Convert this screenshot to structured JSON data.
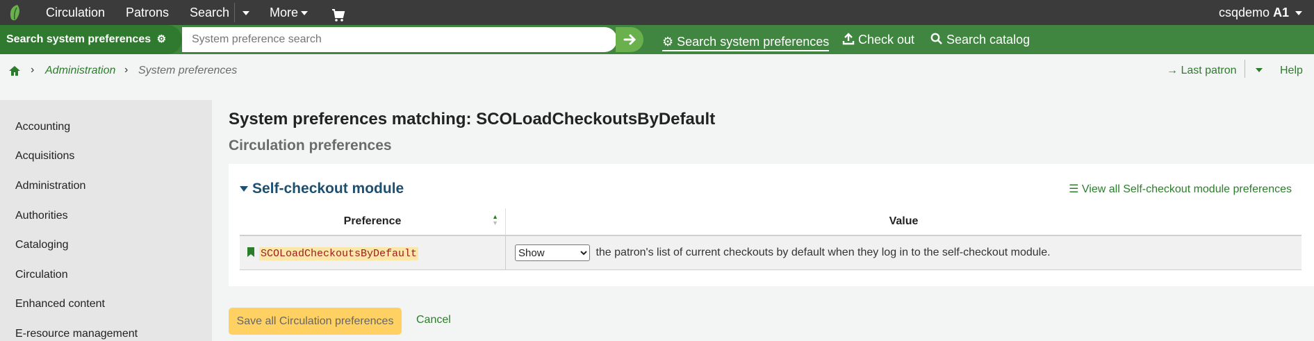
{
  "topnav": {
    "items": [
      "Circulation",
      "Patrons",
      "Search",
      "More"
    ],
    "user": "csqdemo",
    "branch": "A1"
  },
  "searchbar": {
    "label": "Search system preferences",
    "placeholder": "System preference search",
    "links": [
      "Search system preferences",
      "Check out",
      "Search catalog"
    ]
  },
  "breadcrumb": {
    "items": [
      "Administration",
      "System preferences"
    ],
    "last_patron": "Last patron",
    "help": "Help"
  },
  "sidebar": {
    "items": [
      "Accounting",
      "Acquisitions",
      "Administration",
      "Authorities",
      "Cataloging",
      "Circulation",
      "Enhanced content",
      "E-resource management"
    ]
  },
  "main": {
    "title": "System preferences matching: SCOLoadCheckoutsByDefault",
    "subtitle": "Circulation preferences",
    "section": "Self-checkout module",
    "view_all": "View all Self-checkout module preferences",
    "table": {
      "headers": [
        "Preference",
        "Value"
      ],
      "rows": [
        {
          "name": "SCOLoadCheckoutsByDefault",
          "select_value": "Show",
          "description": "the patron's list of current checkouts by default when they log in to the self-checkout module."
        }
      ]
    },
    "save_label": "Save all Circulation preferences",
    "cancel_label": "Cancel"
  },
  "colors": {
    "topnav": "#3b3b3b",
    "greenbar": "#408540",
    "link": "#2b7d2b",
    "section": "#1d4f70",
    "save_button": "#ffd163"
  }
}
